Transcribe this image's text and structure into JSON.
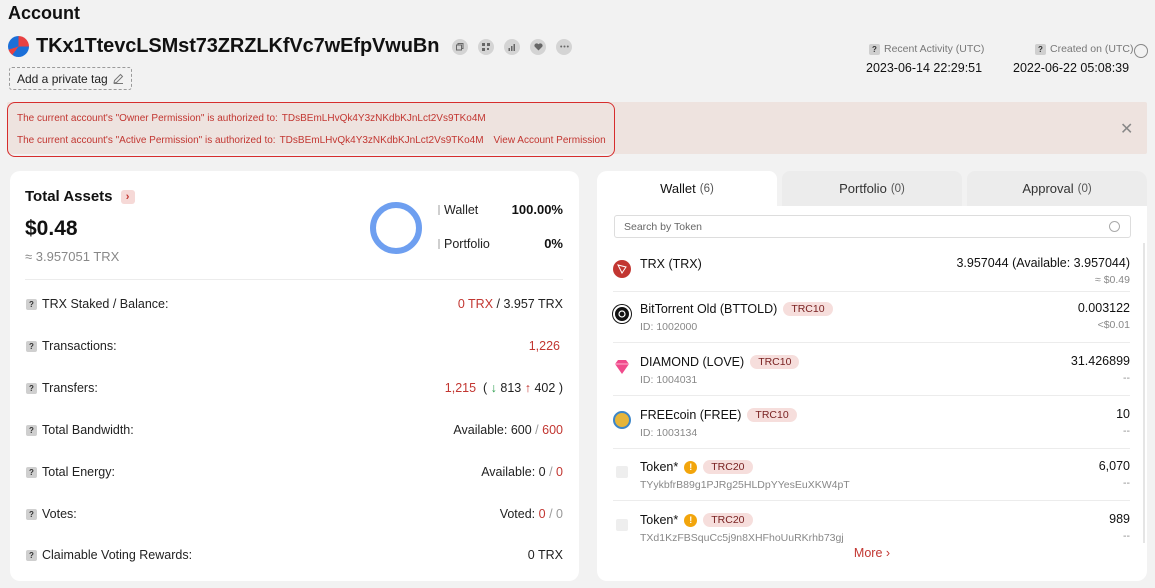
{
  "page": {
    "title": "Account"
  },
  "account": {
    "address": "TKx1TtevcLSMst73ZRZLKfVc7wEfpVwuBn",
    "private_tag_label": "Add a private tag",
    "recent_activity_label": "Recent Activity (UTC)",
    "recent_activity": "2023-06-14 22:29:51",
    "created_on_label": "Created on (UTC)",
    "created_on": "2022-06-22 05:08:39"
  },
  "permissions": {
    "owner_text": "The current account's \"Owner Permission\" is authorized to:",
    "owner_addr": "TDsBEmLHvQk4Y3zNKdbKJnLct2Vs9TKo4M",
    "active_text": "The current account's \"Active Permission\" is authorized to:",
    "active_addr": "TDsBEmLHvQk4Y3zNKdbKJnLct2Vs9TKo4M",
    "view_link": "View Account Permission"
  },
  "total_assets": {
    "title": "Total Assets",
    "usd": "$0.48",
    "trx": "≈ 3.957051 TRX",
    "legend": [
      {
        "label": "Wallet",
        "pct": "100.00%"
      },
      {
        "label": "Portfolio",
        "pct": "0%"
      }
    ]
  },
  "stats": {
    "staked": {
      "label": "TRX Staked / Balance:",
      "staked": "0 TRX",
      "balance": "/ 3.957 TRX"
    },
    "transactions": {
      "label": "Transactions:",
      "value": "1,226"
    },
    "transfers": {
      "label": "Transfers:",
      "total": "1,215",
      "open": "(",
      "in": "813",
      "out": "402",
      "close": ")"
    },
    "bandwidth": {
      "label": "Total Bandwidth:",
      "avail": "Available: 600",
      "sep": "/",
      "total": "600"
    },
    "energy": {
      "label": "Total Energy:",
      "avail": "Available: 0",
      "sep": "/",
      "total": "0"
    },
    "votes": {
      "label": "Votes:",
      "voted": "Voted:",
      "v1": "0",
      "sep": "/",
      "v2": "0"
    },
    "rewards": {
      "label": "Claimable Voting Rewards:",
      "value": "0 TRX"
    }
  },
  "tabs": [
    {
      "label": "Wallet",
      "count": "(6)"
    },
    {
      "label": "Portfolio",
      "count": "(0)"
    },
    {
      "label": "Approval",
      "count": "(0)"
    }
  ],
  "search": {
    "placeholder": "Search by Token"
  },
  "tokens": [
    {
      "name": "TRX (TRX)",
      "badge": "",
      "sub": "",
      "amount": "3.957044 (Available: 3.957044)",
      "value": "≈ $0.49"
    },
    {
      "name": "BitTorrent Old (BTTOLD)",
      "badge": "TRC10",
      "sub": "ID: 1002000",
      "amount": "0.003122",
      "value": "<$0.01"
    },
    {
      "name": "DIAMOND (LOVE)",
      "badge": "TRC10",
      "sub": "ID: 1004031",
      "amount": "31.426899",
      "value": "--"
    },
    {
      "name": "FREEcoin (FREE)",
      "badge": "TRC10",
      "sub": "ID: 1003134",
      "amount": "10",
      "value": "--"
    },
    {
      "name": "Token*",
      "badge": "TRC20",
      "sub": "TYykbfrB89g1PJRg25HLDpYYesEuXKW4pT",
      "amount": "6,070",
      "value": "--"
    },
    {
      "name": "Token*",
      "badge": "TRC20",
      "sub": "TXd1KzFBSquCc5j9n8XHFhoUuRKrhb73gj",
      "amount": "989",
      "value": "--"
    }
  ],
  "more_label": "More",
  "icons": {
    "copy": "copy-icon",
    "qr": "qr-code-icon",
    "chart": "chart-icon",
    "fav": "heart-icon",
    "more": "more-icon",
    "edit": "pencil-icon",
    "refresh": "refresh-icon",
    "close": "close-icon",
    "search": "search-icon"
  }
}
